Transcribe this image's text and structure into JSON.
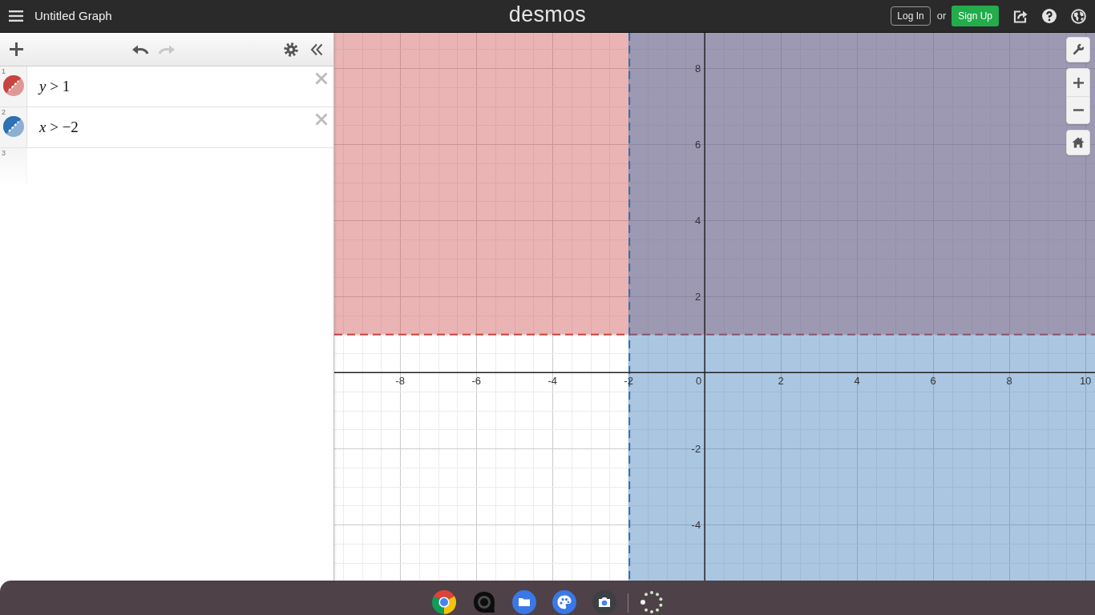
{
  "header": {
    "title": "Untitled Graph",
    "logo": "desmos",
    "login_button": "Log In",
    "or_text": "or",
    "signup_button": "Sign Up"
  },
  "toolbar": {
    "undo_button": {
      "disabled": false
    },
    "redo_button": {
      "disabled": true
    }
  },
  "expressions": [
    {
      "number": "1",
      "expression": "*y* > 1",
      "color": "#c74440"
    },
    {
      "number": "2",
      "expression": "*x* > −2",
      "color": "#2d70b3"
    },
    {
      "number": "3"
    }
  ],
  "graph": {
    "origin_label": "0",
    "chart_data": {
      "type": "line",
      "xlim": [
        -9.73,
        10.25
      ],
      "ylim": [
        -5.47,
        8.93
      ],
      "xticks": [
        -8,
        -6,
        -4,
        -2,
        2,
        4,
        6,
        8,
        10
      ],
      "yticks": [
        -4,
        -2,
        2,
        4,
        6,
        8
      ],
      "grid": true,
      "bands": [
        {
          "axis": "y",
          "from": 1,
          "to": 8.93,
          "color": "#c74440"
        },
        {
          "axis": "x",
          "from": -2,
          "to": 10.25,
          "color": "#2d70b3"
        }
      ],
      "ref_lines": [
        {
          "axis": "y",
          "value": 1,
          "color": "#c74440",
          "line_style": "dashed"
        },
        {
          "axis": "x",
          "value": -2,
          "color": "#2d70b3",
          "line_style": "dashed"
        }
      ]
    }
  }
}
